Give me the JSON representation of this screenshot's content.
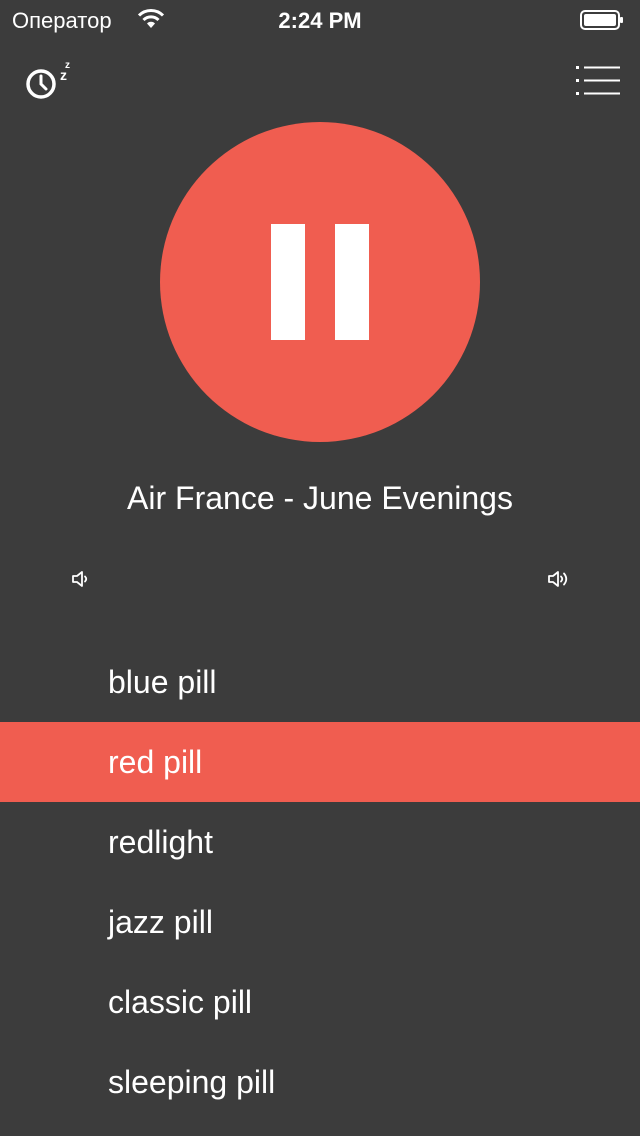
{
  "colors": {
    "background": "#3c3c3c",
    "accent": "#f05d50",
    "text": "#ffffff"
  },
  "status_bar": {
    "carrier": "Оператор",
    "time": "2:24 PM",
    "wifi_icon": "wifi-icon",
    "battery_icon": "battery-full-icon"
  },
  "toolbar": {
    "sleep_timer_icon": "sleep-timer-icon",
    "menu_icon": "hamburger-menu-icon"
  },
  "player": {
    "state_icon": "pause-icon",
    "track_title": "Air France - June Evenings"
  },
  "volume": {
    "low_icon": "volume-low-icon",
    "high_icon": "volume-high-icon"
  },
  "stations": [
    {
      "label": "blue pill",
      "active": false
    },
    {
      "label": "red pill",
      "active": true
    },
    {
      "label": "redlight",
      "active": false
    },
    {
      "label": "jazz pill",
      "active": false
    },
    {
      "label": "classic pill",
      "active": false
    },
    {
      "label": "sleeping pill",
      "active": false
    }
  ]
}
